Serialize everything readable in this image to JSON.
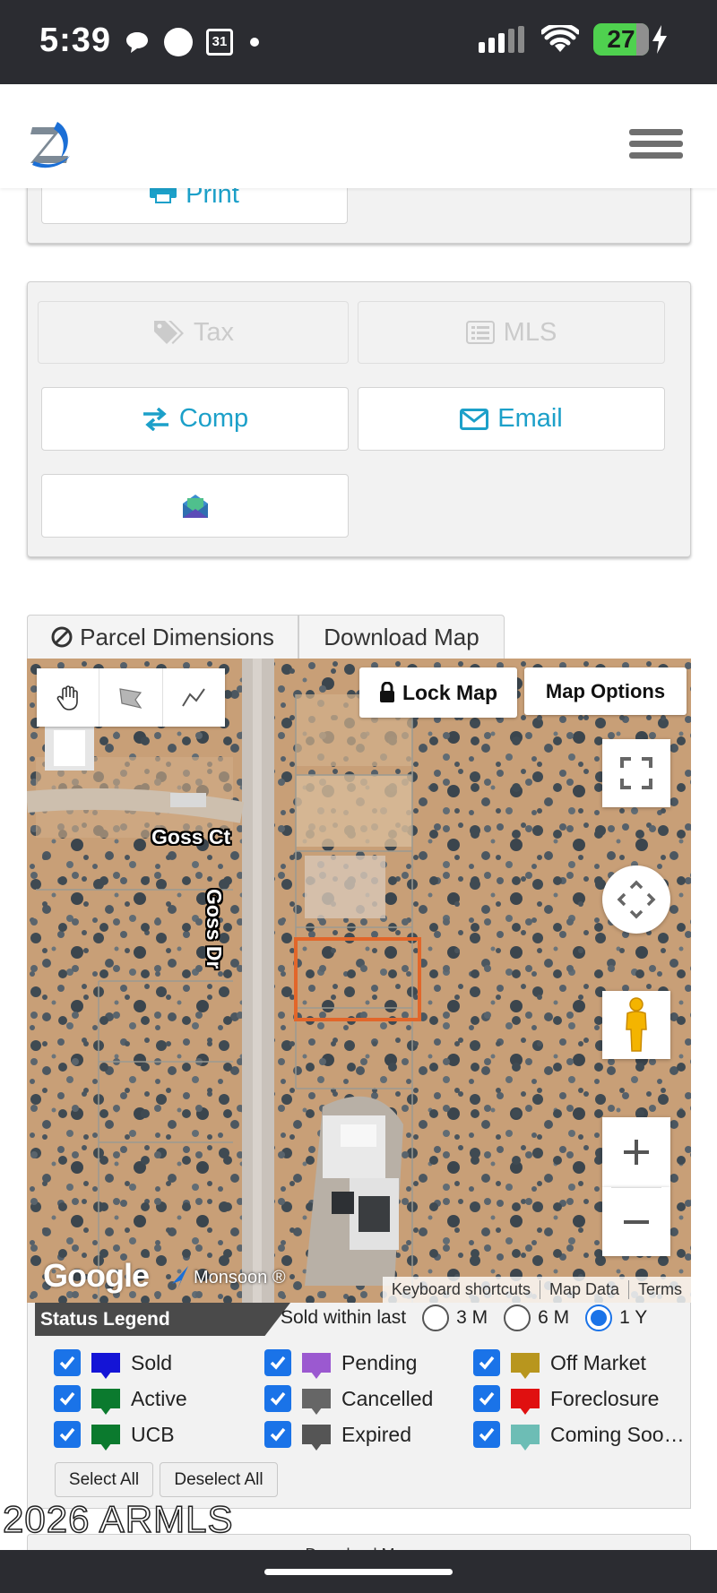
{
  "status_bar": {
    "time": "5:39",
    "calendar_day": "31",
    "battery": "27",
    "icons": [
      "chat-bubble-icon",
      "circle-icon",
      "calendar-icon",
      "dot-icon",
      "signal-icon",
      "wifi-icon",
      "battery-icon",
      "charging-icon"
    ]
  },
  "header": {
    "logo_icon": "brand-z-logo-icon",
    "menu_icon": "hamburger-menu-icon"
  },
  "top_panel": {
    "print_label": "Print"
  },
  "actions_panel": {
    "tax_label": "Tax",
    "mls_label": "MLS",
    "comp_label": "Comp",
    "email_label": "Email",
    "envelope_button_icon": "colored-envelope-icon"
  },
  "tabs": {
    "parcel_dimensions": "Parcel Dimensions",
    "download_map": "Download Map"
  },
  "map": {
    "lock_map": "Lock Map",
    "map_options": "Map Options",
    "road_goss_ct": "Goss Ct",
    "road_goss_dr": "Goss Dr",
    "google_label": "Google",
    "monsoon_label": "Monsoon ®",
    "keyboard_shortcuts": "Keyboard shortcuts",
    "map_data": "Map Data",
    "terms": "Terms",
    "colors": {
      "parcel_outline": "#e2662a"
    }
  },
  "legend": {
    "title": "Status Legend",
    "sold_within": "Sold within last",
    "periods": [
      "3 M",
      "6 M",
      "1 Y"
    ],
    "selected_period": "1 Y",
    "items": [
      {
        "label": "Sold",
        "color": "#1414d6",
        "checked": true
      },
      {
        "label": "Pending",
        "color": "#9b59d0",
        "checked": true
      },
      {
        "label": "Off Market",
        "color": "#b8961e",
        "checked": true
      },
      {
        "label": "Active",
        "color": "#0b7a2e",
        "checked": true
      },
      {
        "label": "Cancelled",
        "color": "#666666",
        "checked": true
      },
      {
        "label": "Foreclosure",
        "color": "#e01010",
        "checked": true
      },
      {
        "label": "UCB",
        "color": "#0b7a2e",
        "checked": true
      },
      {
        "label": "Expired",
        "color": "#555555",
        "checked": true
      },
      {
        "label": "Coming Soo…",
        "color": "#6dbdb5",
        "checked": true
      }
    ],
    "select_all": "Select All",
    "deselect_all": "Deselect All"
  },
  "footer": {
    "copyright": "2026 ARMLS",
    "next_panel_label": "Download Map"
  }
}
